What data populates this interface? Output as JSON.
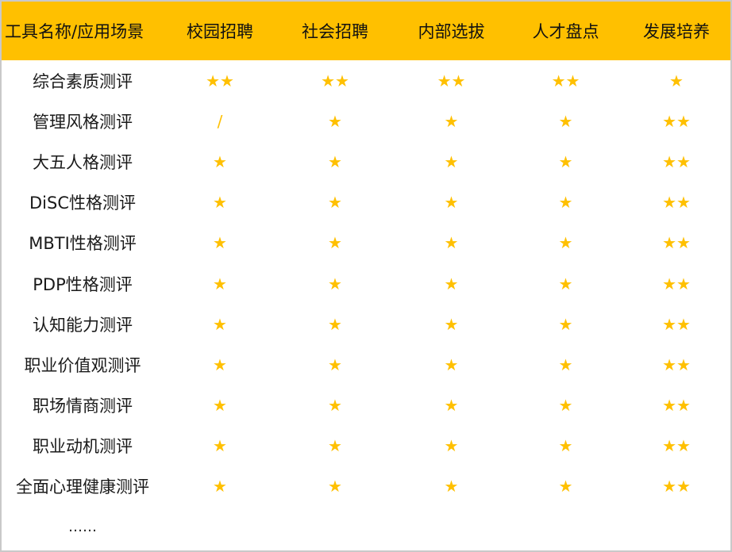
{
  "header": {
    "columns": [
      "工具名称/应用场景",
      "校园招聘",
      "社会招聘",
      "内部选拔",
      "人才盘点",
      "发展培养"
    ]
  },
  "rows": [
    {
      "tool": "综合素质测评",
      "ratings": [
        "★★",
        "★★",
        "★★",
        "★★",
        "★"
      ]
    },
    {
      "tool": "管理风格测评",
      "ratings": [
        "/",
        "★",
        "★",
        "★",
        "★★"
      ]
    },
    {
      "tool": "大五人格测评",
      "ratings": [
        "★",
        "★",
        "★",
        "★",
        "★★"
      ]
    },
    {
      "tool": "DiSC性格测评",
      "ratings": [
        "★",
        "★",
        "★",
        "★",
        "★★"
      ]
    },
    {
      "tool": "MBTI性格测评",
      "ratings": [
        "★",
        "★",
        "★",
        "★",
        "★★"
      ]
    },
    {
      "tool": "PDP性格测评",
      "ratings": [
        "★",
        "★",
        "★",
        "★",
        "★★"
      ]
    },
    {
      "tool": "认知能力测评",
      "ratings": [
        "★",
        "★",
        "★",
        "★",
        "★★"
      ]
    },
    {
      "tool": "职业价值观测评",
      "ratings": [
        "★",
        "★",
        "★",
        "★",
        "★★"
      ]
    },
    {
      "tool": "职场情商测评",
      "ratings": [
        "★",
        "★",
        "★",
        "★",
        "★★"
      ]
    },
    {
      "tool": "职业动机测评",
      "ratings": [
        "★",
        "★",
        "★",
        "★",
        "★★"
      ]
    },
    {
      "tool": "全面心理健康测评",
      "ratings": [
        "★",
        "★",
        "★",
        "★",
        "★★"
      ]
    }
  ],
  "more": "……",
  "colors": {
    "header_bg": "#ffc000",
    "star": "#ffc000",
    "border": "#c9c9c9"
  }
}
